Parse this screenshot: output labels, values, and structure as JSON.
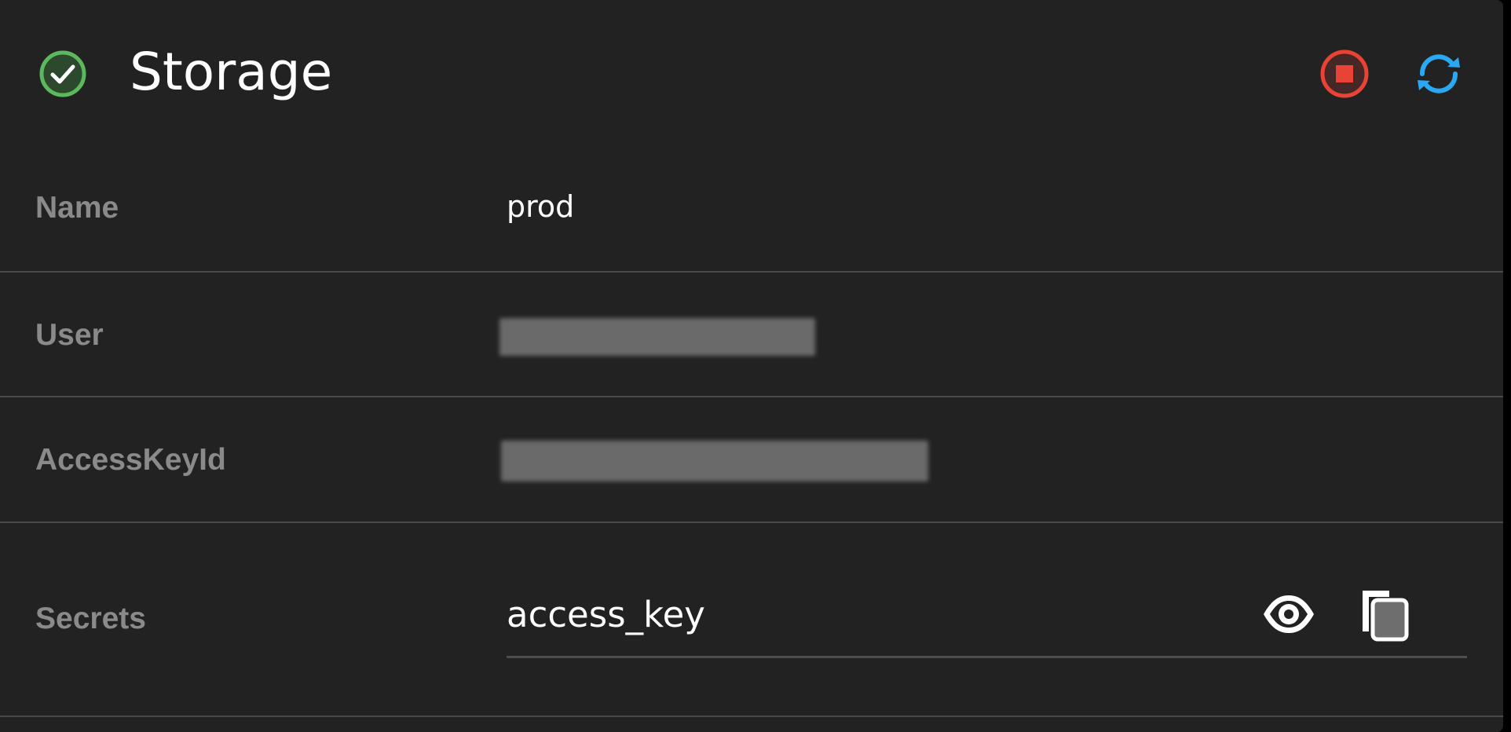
{
  "header": {
    "title": "Storage",
    "status": "running",
    "status_icon": "check-circle-icon",
    "stop_icon": "stop-circle-icon",
    "refresh_icon": "sync-icon"
  },
  "fields": {
    "name": {
      "label": "Name",
      "value": "prod"
    },
    "user": {
      "label": "User",
      "value_redacted": true
    },
    "access_key_id": {
      "label": "AccessKeyId",
      "value_redacted": true
    },
    "secrets": {
      "label": "Secrets",
      "value": "access_key",
      "reveal_icon": "eye-icon",
      "copy_icon": "copy-icon"
    }
  },
  "colors": {
    "panel_background": "#222222",
    "status_ok": "#5cb85c",
    "stop": "#e84335",
    "refresh": "#2aa8f2",
    "label": "#8a8a8a",
    "divider": "#4a4a4a"
  }
}
